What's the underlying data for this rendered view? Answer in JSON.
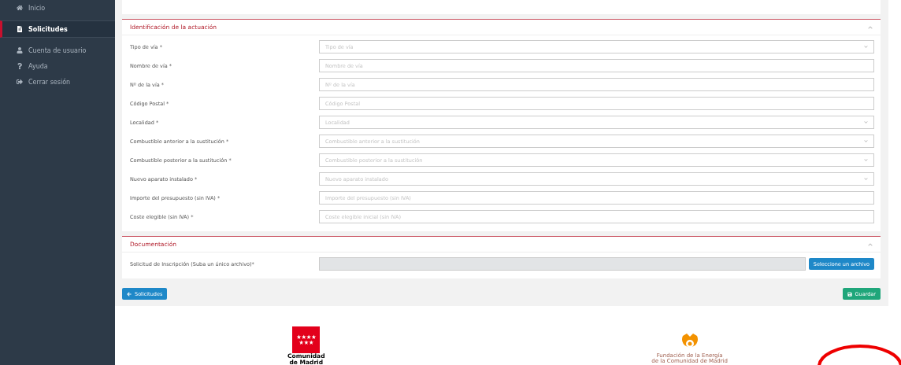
{
  "sidebar": {
    "items": [
      {
        "label": "Inicio",
        "selected": false
      },
      {
        "label": "Solicitudes",
        "selected": true
      },
      {
        "label": "Cuenta de usuario",
        "selected": false
      },
      {
        "label": "Ayuda",
        "selected": false
      },
      {
        "label": "Cerrar sesión",
        "selected": false
      }
    ]
  },
  "sections": [
    {
      "title": "Identificación de la actuación",
      "expanded": true,
      "fields": [
        {
          "kind": "select",
          "label": "Tipo de vía *",
          "placeholder": "Tipo de vía"
        },
        {
          "kind": "text",
          "label": "Nombre de vía *",
          "placeholder": "Nombre de vía"
        },
        {
          "kind": "text",
          "label": "Nº de la vía *",
          "placeholder": "Nº de la vía"
        },
        {
          "kind": "text",
          "label": "Código Postal *",
          "placeholder": "Código Postal"
        },
        {
          "kind": "select",
          "label": "Localidad *",
          "placeholder": "Localidad"
        },
        {
          "kind": "select",
          "label": "Combustible anterior a la sustitución *",
          "placeholder": "Combustible anterior a la sustitución"
        },
        {
          "kind": "select",
          "label": "Combustible posterior a la sustitución *",
          "placeholder": "Combustible posterior a la sustitución"
        },
        {
          "kind": "select",
          "label": "Nuevo aparato instalado *",
          "placeholder": "Nuevo aparato instalado"
        },
        {
          "kind": "text",
          "label": "Importe del presupuesto (sin IVA) *",
          "placeholder": "Importe del presupuesto (sin IVA)"
        },
        {
          "kind": "text",
          "label": "Coste elegible (sin IVA) *",
          "placeholder": "Coste elegible inicial (sin IVA)"
        }
      ]
    },
    {
      "title": "Documentación",
      "expanded": true,
      "fields": [
        {
          "kind": "file",
          "label": "Solicitud de Inscripción (Suba un único archivo)*",
          "button": "Seleccione un archivo"
        }
      ]
    }
  ],
  "actions": {
    "back": "Solicitudes",
    "save": "Guardar"
  },
  "footer": {
    "left_logo": {
      "line1": "Comunidad",
      "line2": "de Madrid"
    },
    "right_logo": {
      "line1": "Fundación de la Energía",
      "line2": "de la Comunidad de Madrid"
    }
  }
}
